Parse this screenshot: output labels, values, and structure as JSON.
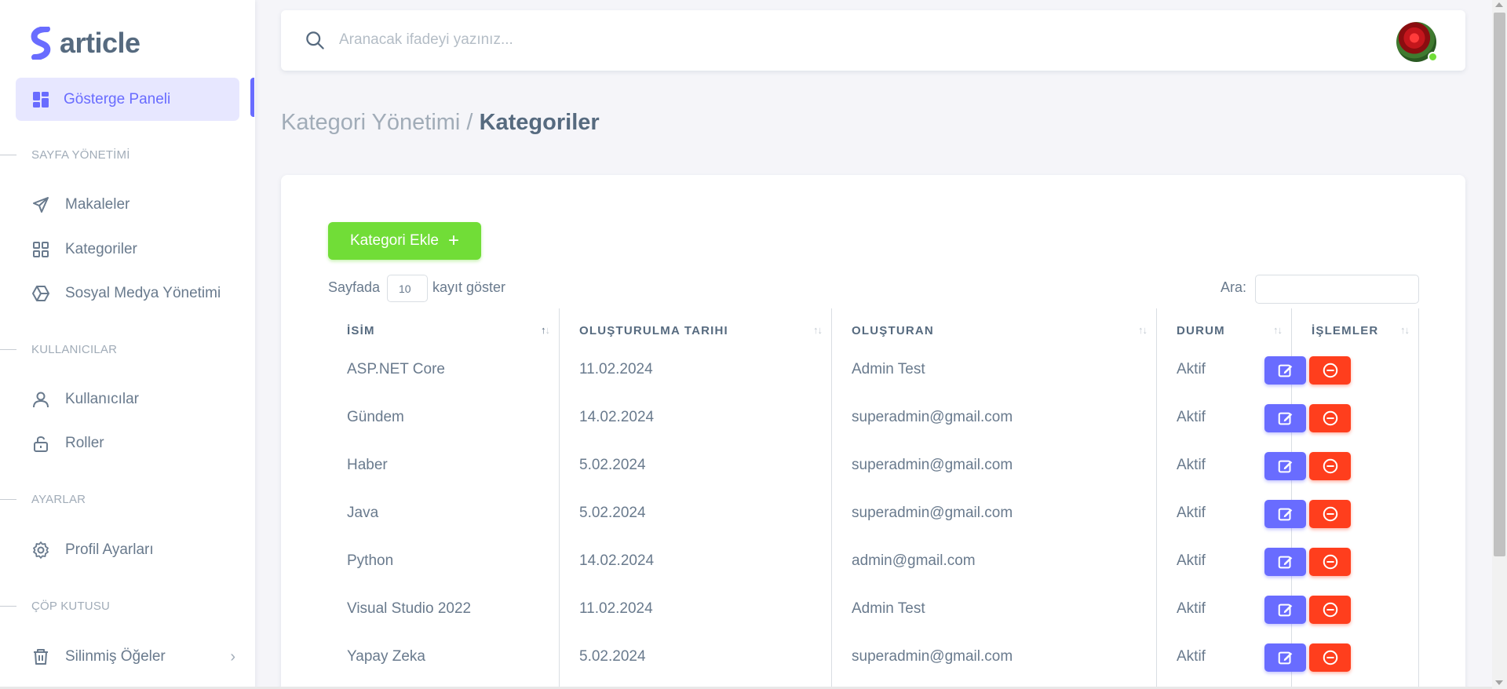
{
  "brand": {
    "name": "article",
    "color": "#696cff"
  },
  "sidebar": {
    "active_item": {
      "label": "Gösterge Paneli",
      "icon": "dashboard-icon"
    },
    "sections": [
      {
        "header": "SAYFA YÖNETİMİ",
        "items": [
          {
            "label": "Makaleler",
            "icon": "send-icon"
          },
          {
            "label": "Kategoriler",
            "icon": "grid-icon"
          },
          {
            "label": "Sosyal Medya Yönetimi",
            "icon": "hexagon-icon"
          }
        ]
      },
      {
        "header": "KULLANICILAR",
        "items": [
          {
            "label": "Kullanıcılar",
            "icon": "user-icon"
          },
          {
            "label": "Roller",
            "icon": "lock-open-icon"
          }
        ]
      },
      {
        "header": "AYARLAR",
        "items": [
          {
            "label": "Profil Ayarları",
            "icon": "gear-icon"
          }
        ]
      },
      {
        "header": "ÇÖP KUTUSU",
        "items": [
          {
            "label": "Silinmiş Öğeler",
            "icon": "trash-icon",
            "chevron": "›"
          }
        ]
      }
    ]
  },
  "navbar": {
    "search_placeholder": "Aranacak ifadeyi yazınız...",
    "avatar_status": "online"
  },
  "breadcrumb": {
    "parent": "Kategori Yönetimi /",
    "current": "Kategoriler"
  },
  "toolbar": {
    "add_label": "Kategori Ekle",
    "add_icon": "+"
  },
  "table_controls": {
    "length_prefix": "Sayfada",
    "length_value": "10",
    "length_suffix": "kayıt göster",
    "search_label": "Ara:"
  },
  "table": {
    "columns": [
      "İSİM",
      "OLUŞTURULMA TARIHI",
      "OLUŞTURAN",
      "DURUM",
      "İŞLEMLER"
    ],
    "rows": [
      {
        "name": "ASP.NET Core",
        "date": "11.02.2024",
        "creator": "Admin Test",
        "status": "Aktif"
      },
      {
        "name": "Gündem",
        "date": "14.02.2024",
        "creator": "superadmin@gmail.com",
        "status": "Aktif"
      },
      {
        "name": "Haber",
        "date": "5.02.2024",
        "creator": "superadmin@gmail.com",
        "status": "Aktif"
      },
      {
        "name": "Java",
        "date": "5.02.2024",
        "creator": "superadmin@gmail.com",
        "status": "Aktif"
      },
      {
        "name": "Python",
        "date": "14.02.2024",
        "creator": "admin@gmail.com",
        "status": "Aktif"
      },
      {
        "name": "Visual Studio 2022",
        "date": "11.02.2024",
        "creator": "Admin Test",
        "status": "Aktif"
      },
      {
        "name": "Yapay Zeka",
        "date": "5.02.2024",
        "creator": "superadmin@gmail.com",
        "status": "Aktif"
      }
    ]
  },
  "colors": {
    "primary": "#696cff",
    "success": "#71dd37",
    "danger": "#ff3e1d"
  }
}
